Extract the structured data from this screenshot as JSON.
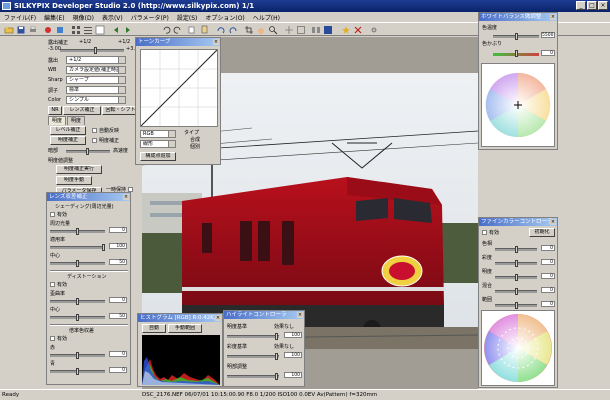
{
  "window": {
    "title": "SILKYPIX Developer Studio 2.0 (http://www.silkypix.com)  1/1"
  },
  "menu": [
    "ファイル(F)",
    "編集(E)",
    "現像(D)",
    "表示(V)",
    "パラメータ(P)",
    "設定(S)",
    "オプション(O)",
    "ヘルプ(H)"
  ],
  "left_panel": {
    "exposure_label": "露出補正",
    "exposure_value": "+1/2",
    "exposure_value2": "+1/2",
    "exposure_min": "-3.00",
    "exposure_max": "+3.00",
    "rows": [
      {
        "label": "露出",
        "value": "+1/2"
      },
      {
        "label": "WB",
        "value": "カメラ設定値(補正時設定)"
      },
      {
        "label": "Sharp",
        "value": "シャープ"
      },
      {
        "label": "調子",
        "value": "標準"
      },
      {
        "label": "Color",
        "value": "シンプル"
      }
    ],
    "nr_label": "NR",
    "lens_btn": "レンズ補正",
    "rotate_btn": "回転・シフト",
    "tab_exposure": "明度",
    "tab_contrast": "明度",
    "curve_btn": "レベル補正",
    "auto_label": "自動反映",
    "brightness_label": "明度補正",
    "brightness_btn": "明度補正",
    "dark_label": "暗部",
    "bright_label": "高速度",
    "extra_label": "明度値調整",
    "exec_btn": "明度補正実行",
    "manual_btn": "明度手動",
    "param_btn": "パラメータ保存",
    "check_label": "一時保持"
  },
  "lens_panel": {
    "title": "レンズ収差補正",
    "section1": "シェーディング(周辺光量)",
    "enable1": "有効",
    "row1": "周辺光量",
    "row2": "適用率",
    "row3": "中心",
    "section2": "ディストーション",
    "enable2": "有効",
    "row4": "歪曲率",
    "row5": "中心",
    "section3": "倍率色収差",
    "enable3": "有効",
    "row6": "赤",
    "row7": "青",
    "v1": "0",
    "v2": "100",
    "v3": "50",
    "v4": "0",
    "v5": "50",
    "v6": "0",
    "v7": "0"
  },
  "tone_panel": {
    "title": "トーンカーブ",
    "type_label": "タイプ",
    "opt1": "合成",
    "opt2": "個別",
    "combo1": "RGB",
    "combo2": "線形",
    "btn": "構成点追加"
  },
  "histogram_panel": {
    "title": "ヒストグラム [RGB] R:0.42K, G:0.30...",
    "auto_btn": "自動",
    "manual_btn": "手動範囲"
  },
  "highlight_panel": {
    "title": "ハイライトコントローラ",
    "rows": [
      "明度基準",
      "彩度基準",
      "明部調整"
    ],
    "checks": [
      "効果なし",
      "効果なし"
    ],
    "values": [
      "100",
      "100",
      "100"
    ]
  },
  "wb_panel": {
    "title": "ホワイトバランス微調整",
    "rows": [
      "色温度",
      "色かぶり"
    ],
    "values": [
      "5500",
      "0"
    ]
  },
  "fine_panel": {
    "title": "ファインカラーコントローラ",
    "enable": "有効",
    "btn": "初期化",
    "rows": [
      "色相",
      "彩度",
      "明度",
      "混合",
      "範囲"
    ],
    "values": [
      "0",
      "0",
      "0",
      "0",
      "0"
    ]
  },
  "status": {
    "left": "Ready",
    "file": "DSC_2176.NEF  06/07/01 10:15:00.90  F8.0  1/200  ISO100  0.0EV  Av(Pattern)  f=320mm"
  },
  "colors": {
    "accent": "#0a246a",
    "panel_bg": "#d4d0c8",
    "locomotive": "#c8102e"
  }
}
